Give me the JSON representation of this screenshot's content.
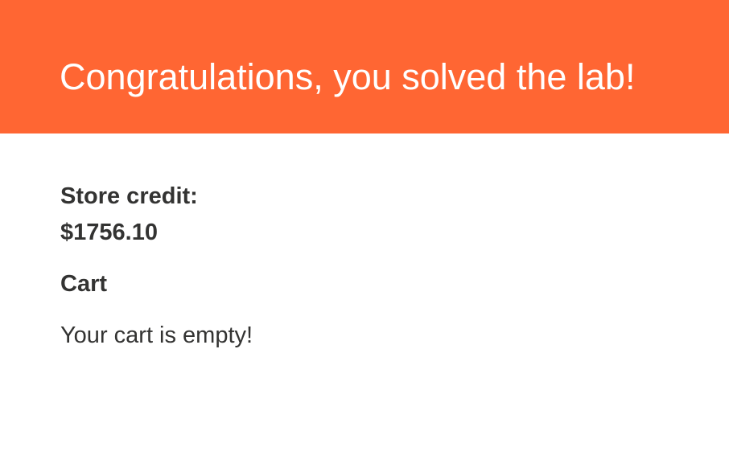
{
  "banner": {
    "message": "Congratulations, you solved the lab!",
    "background_color": "#ff6633",
    "text_color": "#ffffff"
  },
  "account": {
    "store_credit_label": "Store credit:",
    "store_credit_value": "$1756.10"
  },
  "cart": {
    "heading": "Cart",
    "empty_message": "Your cart is empty!"
  },
  "colors": {
    "text": "#333332",
    "page_background": "#ffffff"
  }
}
